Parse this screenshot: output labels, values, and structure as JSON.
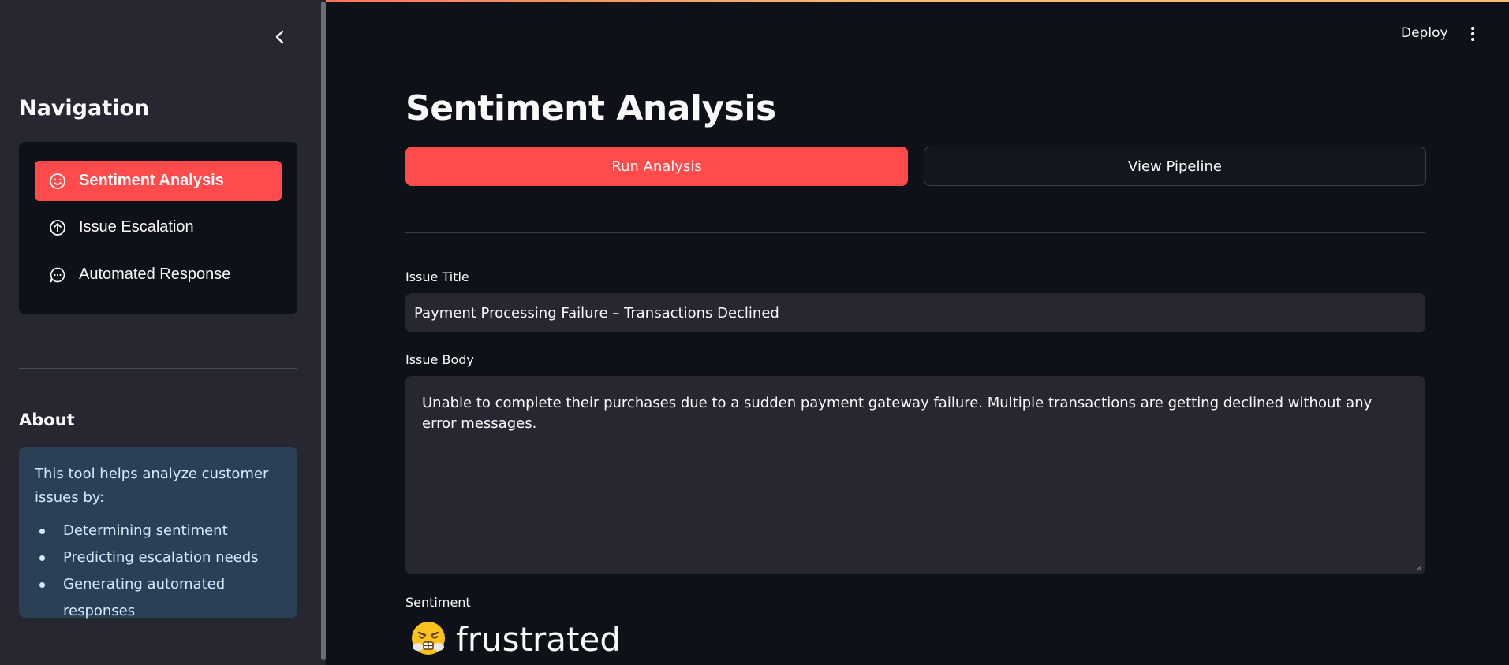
{
  "header": {
    "deploy_label": "Deploy",
    "menu_icon": "kebab-menu-icon"
  },
  "sidebar": {
    "collapse_icon": "chevron-left-icon",
    "nav_heading": "Navigation",
    "items": [
      {
        "label": "Sentiment Analysis",
        "icon": "smile-icon",
        "active": true
      },
      {
        "label": "Issue Escalation",
        "icon": "arrow-up-circle-icon",
        "active": false
      },
      {
        "label": "Automated Response",
        "icon": "chat-bubble-icon",
        "active": false
      }
    ],
    "about_heading": "About",
    "about_text": "This tool helps analyze customer issues by:",
    "about_points": [
      "Determining sentiment",
      "Predicting escalation needs",
      "Generating automated responses"
    ]
  },
  "main": {
    "title": "Sentiment Analysis",
    "run_button": "Run Analysis",
    "pipeline_button": "View Pipeline",
    "issue_title_label": "Issue Title",
    "issue_title_value": "Payment Processing Failure – Transactions Declined",
    "issue_body_label": "Issue Body",
    "issue_body_value": "Unable to complete their purchases due to a sudden payment gateway failure. Multiple transactions are getting declined without any error messages.",
    "sentiment_label": "Sentiment",
    "sentiment_value": "frustrated",
    "sentiment_icon": "frustrated-face-emoji"
  },
  "colors": {
    "accent": "#ff4b4b",
    "background": "#0e1117",
    "sidebar": "#262730",
    "info_box": "#2b3f55"
  }
}
